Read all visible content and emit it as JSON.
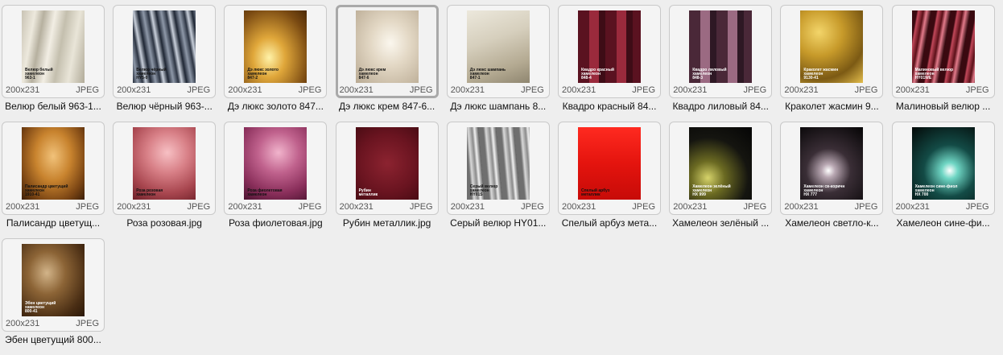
{
  "items": [
    {
      "caption": "Велюр белый 963-1...",
      "thumb_label": "Велюр белый\nхамелеон\n963-1",
      "dims": "200x231",
      "format": "JPEG",
      "texture": "t-velour-white",
      "light": false,
      "selected": false
    },
    {
      "caption": "Велюр чёрный 963-...",
      "thumb_label": "Велюр чёрный\nхамелеон\nHY5-0",
      "dims": "200x231",
      "format": "JPEG",
      "texture": "t-velour-black",
      "light": false,
      "selected": false
    },
    {
      "caption": "Дэ люкс золото 847...",
      "thumb_label": "Дэ люкс золото\nхамелеон\n847-2",
      "dims": "200x231",
      "format": "JPEG",
      "texture": "t-gold",
      "light": false,
      "selected": false
    },
    {
      "caption": "Дэ люкс крем 847-6...",
      "thumb_label": "Дэ люкс крем\nхамелеон\n847-6",
      "dims": "200x231",
      "format": "JPEG",
      "texture": "t-cream",
      "light": false,
      "selected": true
    },
    {
      "caption": "Дэ люкс шампань 8...",
      "thumb_label": "Дэ люкс шампань\nхамелеон\n847-1",
      "dims": "200x231",
      "format": "JPEG",
      "texture": "t-champagne",
      "light": false,
      "selected": false
    },
    {
      "caption": "Квадро красный 84...",
      "thumb_label": "Квадро красный\nхамелеон\n848-4",
      "dims": "200x231",
      "format": "JPEG",
      "texture": "t-kvadro-red",
      "light": true,
      "selected": false
    },
    {
      "caption": "Квадро лиловый 84...",
      "thumb_label": "Квадро лиловый\nхамелеон\n848-3",
      "dims": "200x231",
      "format": "JPEG",
      "texture": "t-kvadro-lil",
      "light": true,
      "selected": false
    },
    {
      "caption": "Краколет жасмин 9...",
      "thumb_label": "Краколет жасмин\nхамелеон\n9130-41",
      "dims": "200x231",
      "format": "JPEG",
      "texture": "t-krakolet",
      "light": true,
      "selected": false
    },
    {
      "caption": "Малиновый велюр ...",
      "thumb_label": "Малиновый велюр\nхамелеон\nHY01WE",
      "dims": "200x231",
      "format": "JPEG",
      "texture": "t-malina",
      "light": true,
      "selected": false
    },
    {
      "caption": "Палисандр цветущ...",
      "thumb_label": "Палисандр цветущий\nхамелеон\n1910-41",
      "dims": "200x231",
      "format": "JPEG",
      "texture": "t-palisandr",
      "light": false,
      "selected": false
    },
    {
      "caption": "Роза розовая.jpg",
      "thumb_label": "Роза розовая\nхамелеон",
      "dims": "200x231",
      "format": "JPEG",
      "texture": "t-rose-pink",
      "light": false,
      "selected": false
    },
    {
      "caption": "Роза фиолетовая.jpg",
      "thumb_label": "Роза фиолетовая\nхамелеон",
      "dims": "200x231",
      "format": "JPEG",
      "texture": "t-rose-violet",
      "light": false,
      "selected": false
    },
    {
      "caption": "Рубин металлик.jpg",
      "thumb_label": "Рубин\nметаллик",
      "dims": "200x231",
      "format": "JPEG",
      "texture": "t-ruby",
      "light": true,
      "selected": false
    },
    {
      "caption": "Серый велюр HY01...",
      "thumb_label": "Серый велюр\nхамелеон\nHY01S",
      "dims": "200x231",
      "format": "JPEG",
      "texture": "t-grey-velour",
      "light": false,
      "selected": false
    },
    {
      "caption": "Спелый арбуз мета...",
      "thumb_label": "Спелый арбуз\nметаллик",
      "dims": "200x231",
      "format": "JPEG",
      "texture": "t-arbuz",
      "light": false,
      "selected": false
    },
    {
      "caption": "Хамелеон зелёный ...",
      "thumb_label": "Хамелеон зелёный\nхамелеон\nHX 999",
      "dims": "200x231",
      "format": "JPEG",
      "texture": "t-cham-green",
      "light": true,
      "selected": false
    },
    {
      "caption": "Хамелеон светло-к...",
      "thumb_label": "Хамелеон св-коричн\nхамелеон\nHX 777",
      "dims": "200x231",
      "format": "JPEG",
      "texture": "t-cham-light",
      "light": true,
      "selected": false
    },
    {
      "caption": "Хамелеон сине-фи...",
      "thumb_label": "Хамелеон сине-фиол\nхамелеон\nHX 700",
      "dims": "200x231",
      "format": "JPEG",
      "texture": "t-cham-blue",
      "light": true,
      "selected": false
    },
    {
      "caption": "Эбен цветущий 800...",
      "thumb_label": "Эбен цветущий\nхамелеон\n800-41",
      "dims": "200x231",
      "format": "JPEG",
      "texture": "t-eben",
      "light": true,
      "selected": false
    }
  ]
}
